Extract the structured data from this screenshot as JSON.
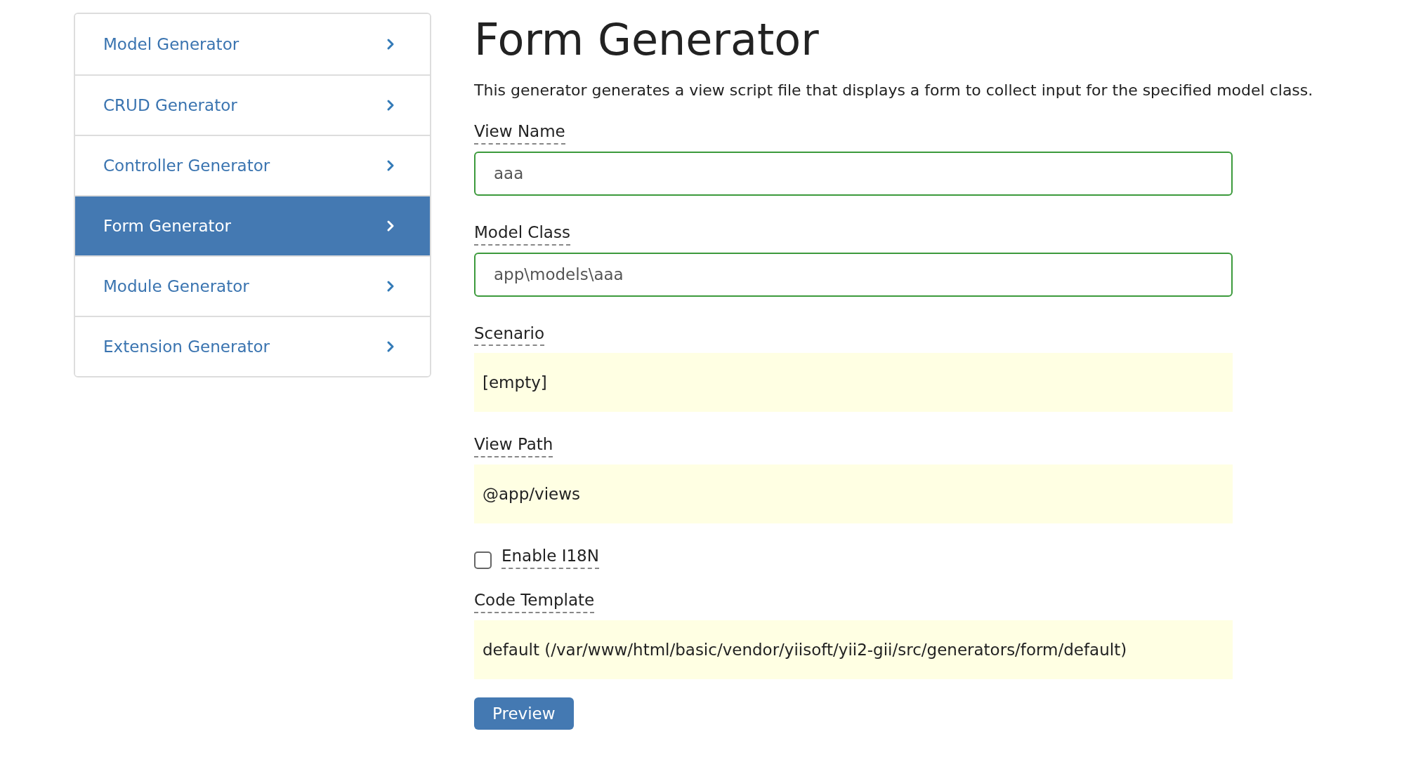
{
  "sidebar": {
    "items": [
      {
        "label": "Model Generator",
        "selected": false
      },
      {
        "label": "CRUD Generator",
        "selected": false
      },
      {
        "label": "Controller Generator",
        "selected": false
      },
      {
        "label": "Form Generator",
        "selected": true
      },
      {
        "label": "Module Generator",
        "selected": false
      },
      {
        "label": "Extension Generator",
        "selected": false
      }
    ]
  },
  "title": "Form Generator",
  "description": "This generator generates a view script file that displays a form to collect input for the specified model class.",
  "fields": [
    {
      "kind": "input",
      "label": "View Name",
      "value": "aaa"
    },
    {
      "kind": "input",
      "label": "Model Class",
      "value": "app\\models\\aaa"
    },
    {
      "kind": "sticky",
      "label": "Scenario",
      "value": "[empty]"
    },
    {
      "kind": "sticky",
      "label": "View Path",
      "value": "@app/views"
    },
    {
      "kind": "checkbox",
      "label": "Enable I18N",
      "checked": false
    },
    {
      "kind": "sticky",
      "label": "Code Template",
      "value": "default (/var/www/html/basic/vendor/yiisoft/yii2-gii/src/generators/form/default)"
    }
  ],
  "button": "Preview"
}
